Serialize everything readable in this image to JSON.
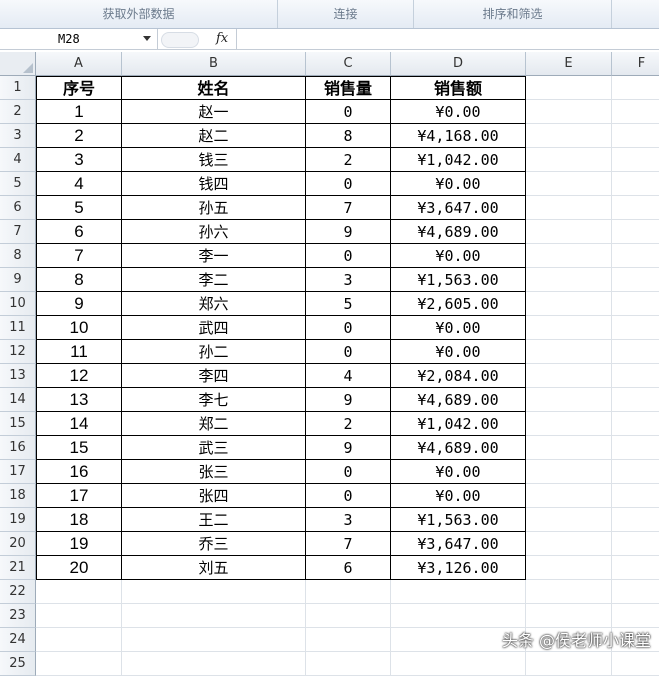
{
  "ribbon": {
    "groups": [
      "获取外部数据",
      "连接",
      "排序和筛选"
    ]
  },
  "formula_bar": {
    "name_box": "M28",
    "fx_icon": "function-icon",
    "formula": ""
  },
  "columns": [
    "A",
    "B",
    "C",
    "D",
    "E",
    "F"
  ],
  "row_numbers": [
    "1",
    "2",
    "3",
    "4",
    "5",
    "6",
    "7",
    "8",
    "9",
    "10",
    "11",
    "12",
    "13",
    "14",
    "15",
    "16",
    "17",
    "18",
    "19",
    "20",
    "21",
    "22",
    "23",
    "24",
    "25"
  ],
  "table": {
    "headers": [
      "序号",
      "姓名",
      "销售量",
      "销售额"
    ],
    "rows": [
      [
        "1",
        "赵一",
        "0",
        "¥0.00"
      ],
      [
        "2",
        "赵二",
        "8",
        "¥4,168.00"
      ],
      [
        "3",
        "钱三",
        "2",
        "¥1,042.00"
      ],
      [
        "4",
        "钱四",
        "0",
        "¥0.00"
      ],
      [
        "5",
        "孙五",
        "7",
        "¥3,647.00"
      ],
      [
        "6",
        "孙六",
        "9",
        "¥4,689.00"
      ],
      [
        "7",
        "李一",
        "0",
        "¥0.00"
      ],
      [
        "8",
        "李二",
        "3",
        "¥1,563.00"
      ],
      [
        "9",
        "郑六",
        "5",
        "¥2,605.00"
      ],
      [
        "10",
        "武四",
        "0",
        "¥0.00"
      ],
      [
        "11",
        "孙二",
        "0",
        "¥0.00"
      ],
      [
        "12",
        "李四",
        "4",
        "¥2,084.00"
      ],
      [
        "13",
        "李七",
        "9",
        "¥4,689.00"
      ],
      [
        "14",
        "郑二",
        "2",
        "¥1,042.00"
      ],
      [
        "15",
        "武三",
        "9",
        "¥4,689.00"
      ],
      [
        "16",
        "张三",
        "0",
        "¥0.00"
      ],
      [
        "17",
        "张四",
        "0",
        "¥0.00"
      ],
      [
        "18",
        "王二",
        "3",
        "¥1,563.00"
      ],
      [
        "19",
        "乔三",
        "7",
        "¥3,647.00"
      ],
      [
        "20",
        "刘五",
        "6",
        "¥3,126.00"
      ]
    ]
  },
  "watermark": "头条 @侯老师小课堂"
}
